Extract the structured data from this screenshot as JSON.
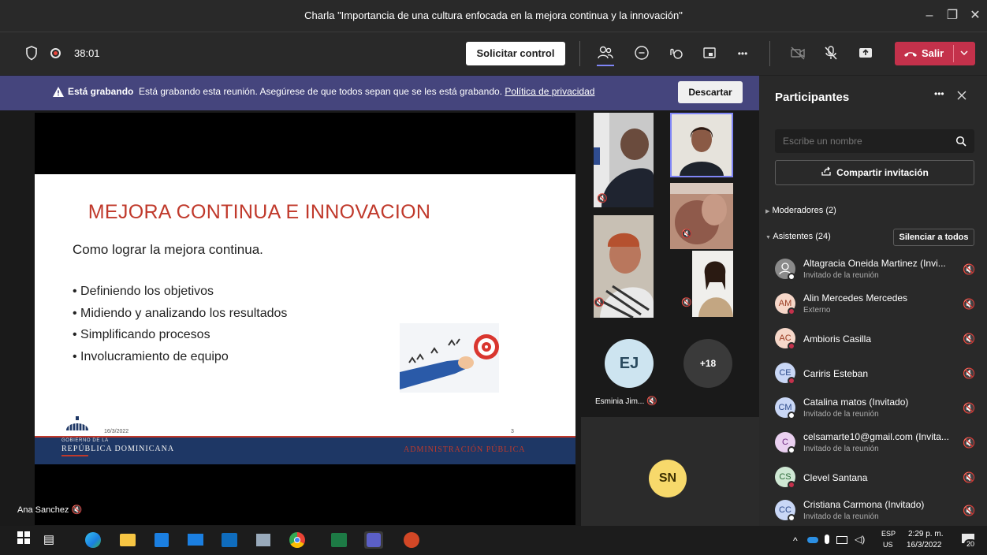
{
  "window": {
    "title": "Charla \"Importancia de una cultura enfocada en la mejora continua y la innovación\"",
    "minimize": "–",
    "maximize": "❐",
    "close": "✕"
  },
  "toolbar": {
    "timer": "38:01",
    "request_control": "Solicitar control",
    "leave": "Salir",
    "more": "•••"
  },
  "banner": {
    "strong": "Está grabando",
    "message": "Está grabando esta reunión. Asegúrese de que todos sepan que se les está grabando.",
    "link": "Política de privacidad",
    "dismiss": "Descartar"
  },
  "slide": {
    "title": "MEJORA CONTINUA E INNOVACION",
    "subtitle": "Como lograr la mejora continua.",
    "bullets": [
      "• Definiendo los objetivos",
      "• Midiendo y analizando los resultados",
      "• Simplificando procesos",
      "• Involucramiento de equipo"
    ],
    "date": "16/3/2022",
    "page": "3",
    "gov_line": "GOBIERNO DE LA",
    "republic": "REPÚBLICA DOMINICANA",
    "admin": "ADMINISTRACIÓN PÚBLICA"
  },
  "presenter": {
    "name": "Ana Sanchez"
  },
  "tiles": {
    "ej_initials": "EJ",
    "ej_name": "Esminia Jim...",
    "more_count": "+18",
    "sn_initials": "SN"
  },
  "panel": {
    "title": "Participantes",
    "search_placeholder": "Escribe un nombre",
    "share": "Compartir invitación",
    "moderators": "Moderadores (2)",
    "attendees": "Asistentes (24)",
    "mute_all": "Silenciar a todos",
    "participants": [
      {
        "initials": "",
        "name": "Altagracia Oneida Martinez (Invi...",
        "sub": "Invitado de la reunión",
        "color": "#8a8a8a"
      },
      {
        "initials": "AM",
        "name": "Alin Mercedes Mercedes",
        "sub": "Externo",
        "color": "#f6d7c9"
      },
      {
        "initials": "AC",
        "name": "Ambioris Casilla",
        "sub": "",
        "color": "#f6d7c9"
      },
      {
        "initials": "CE",
        "name": "Cariris Esteban",
        "sub": "",
        "color": "#c9d7f6"
      },
      {
        "initials": "CM",
        "name": "Catalina matos (Invitado)",
        "sub": "Invitado de la reunión",
        "color": "#c9d7f6"
      },
      {
        "initials": "C",
        "name": "celsamarte10@gmail.com (Invita...",
        "sub": "Invitado de la reunión",
        "color": "#ead0f0"
      },
      {
        "initials": "CS",
        "name": "Clevel Santana",
        "sub": "",
        "color": "#cfe8d4"
      },
      {
        "initials": "CC",
        "name": "Cristiana Carmona (Invitado)",
        "sub": "Invitado de la reunión",
        "color": "#c9d7f6"
      }
    ]
  },
  "taskbar": {
    "lang1": "ESP",
    "lang2": "US",
    "time": "2:29 p. m.",
    "date": "16/3/2022",
    "notif": "20"
  }
}
